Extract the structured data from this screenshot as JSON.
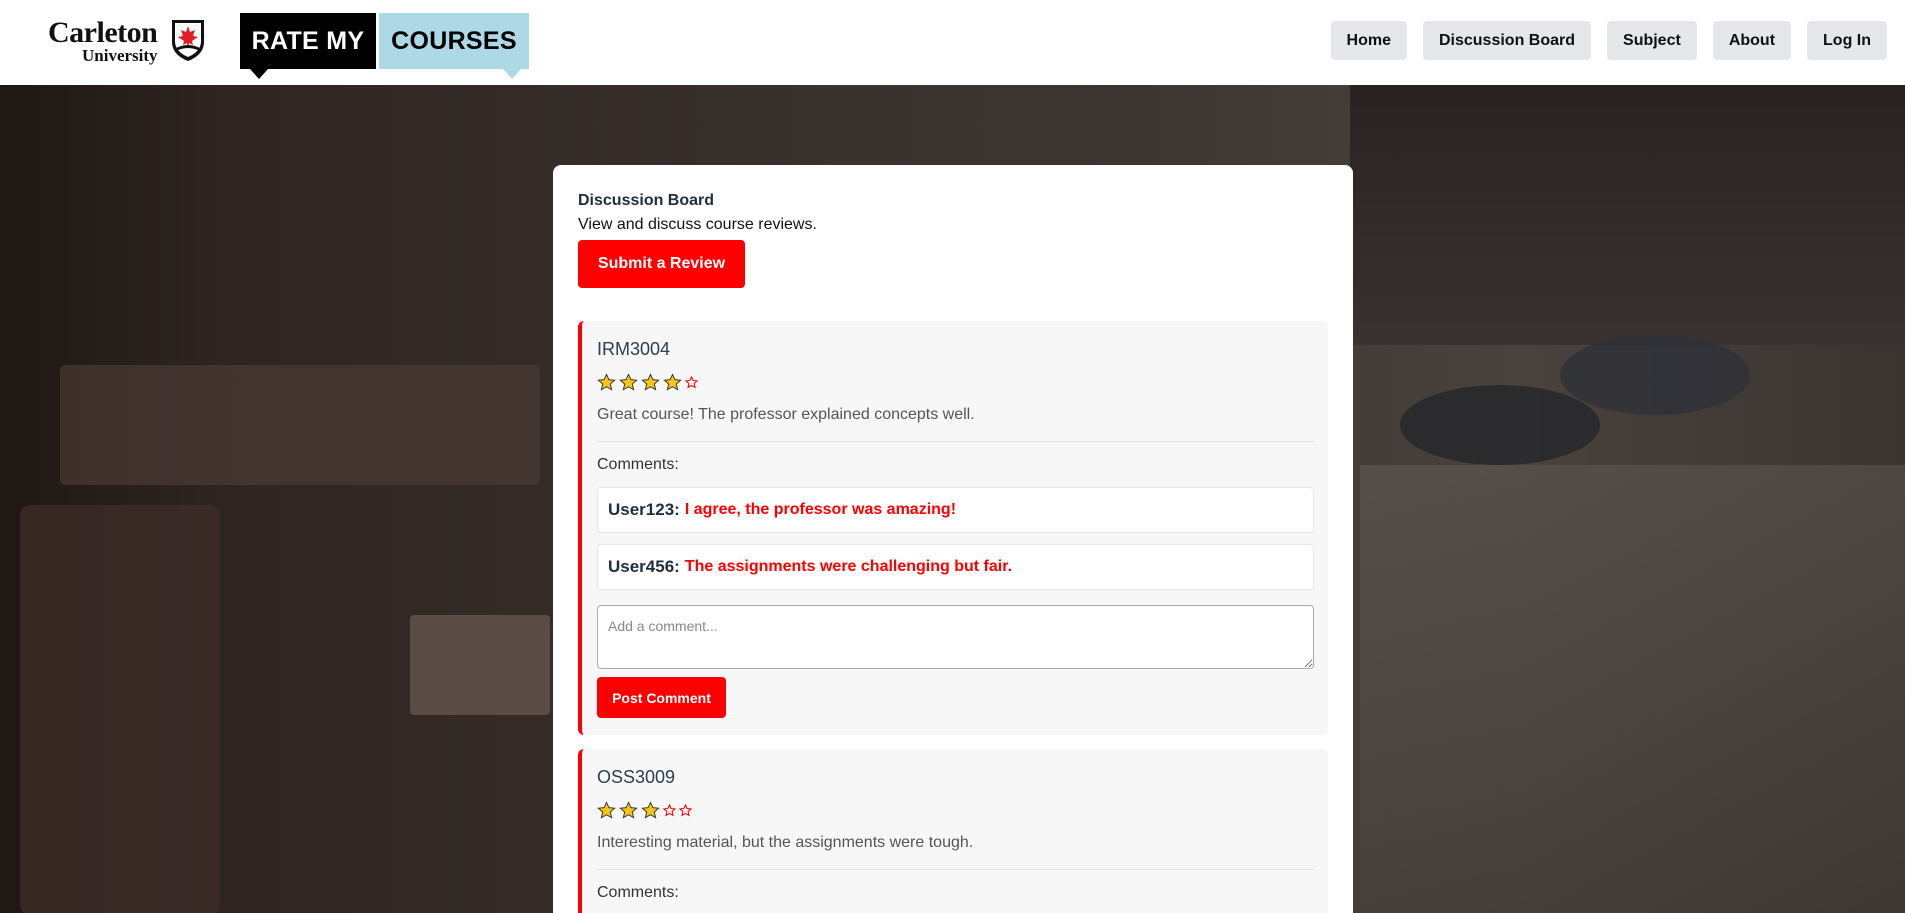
{
  "brand": {
    "logo_main": "Carleton",
    "logo_sub": "University",
    "rate_label": "RATE MY",
    "courses_label": "COURSES"
  },
  "nav": {
    "items": [
      {
        "label": "Home"
      },
      {
        "label": "Discussion Board"
      },
      {
        "label": "Subject"
      },
      {
        "label": "About"
      },
      {
        "label": "Log In"
      }
    ]
  },
  "page": {
    "title": "Discussion Board",
    "subtitle": "View and discuss course reviews.",
    "submit_label": "Submit a Review"
  },
  "reviews": [
    {
      "course": "IRM3004",
      "rating": 4,
      "max_rating": 5,
      "text": "Great course! The professor explained concepts well.",
      "comments_label": "Comments:",
      "comments": [
        {
          "user": "User123:",
          "text": "I agree, the professor was amazing!"
        },
        {
          "user": "User456:",
          "text": "The assignments were challenging but fair."
        }
      ],
      "comment_placeholder": "Add a comment...",
      "post_label": "Post Comment"
    },
    {
      "course": "OSS3009",
      "rating": 3,
      "max_rating": 5,
      "text": "Interesting material, but the assignments were tough.",
      "comments_label": "Comments:"
    }
  ],
  "colors": {
    "accent": "#ff0000",
    "brand_light_blue": "#add8e6",
    "nav_bg": "#e5e7eb",
    "star_fill": "#f5c518"
  }
}
